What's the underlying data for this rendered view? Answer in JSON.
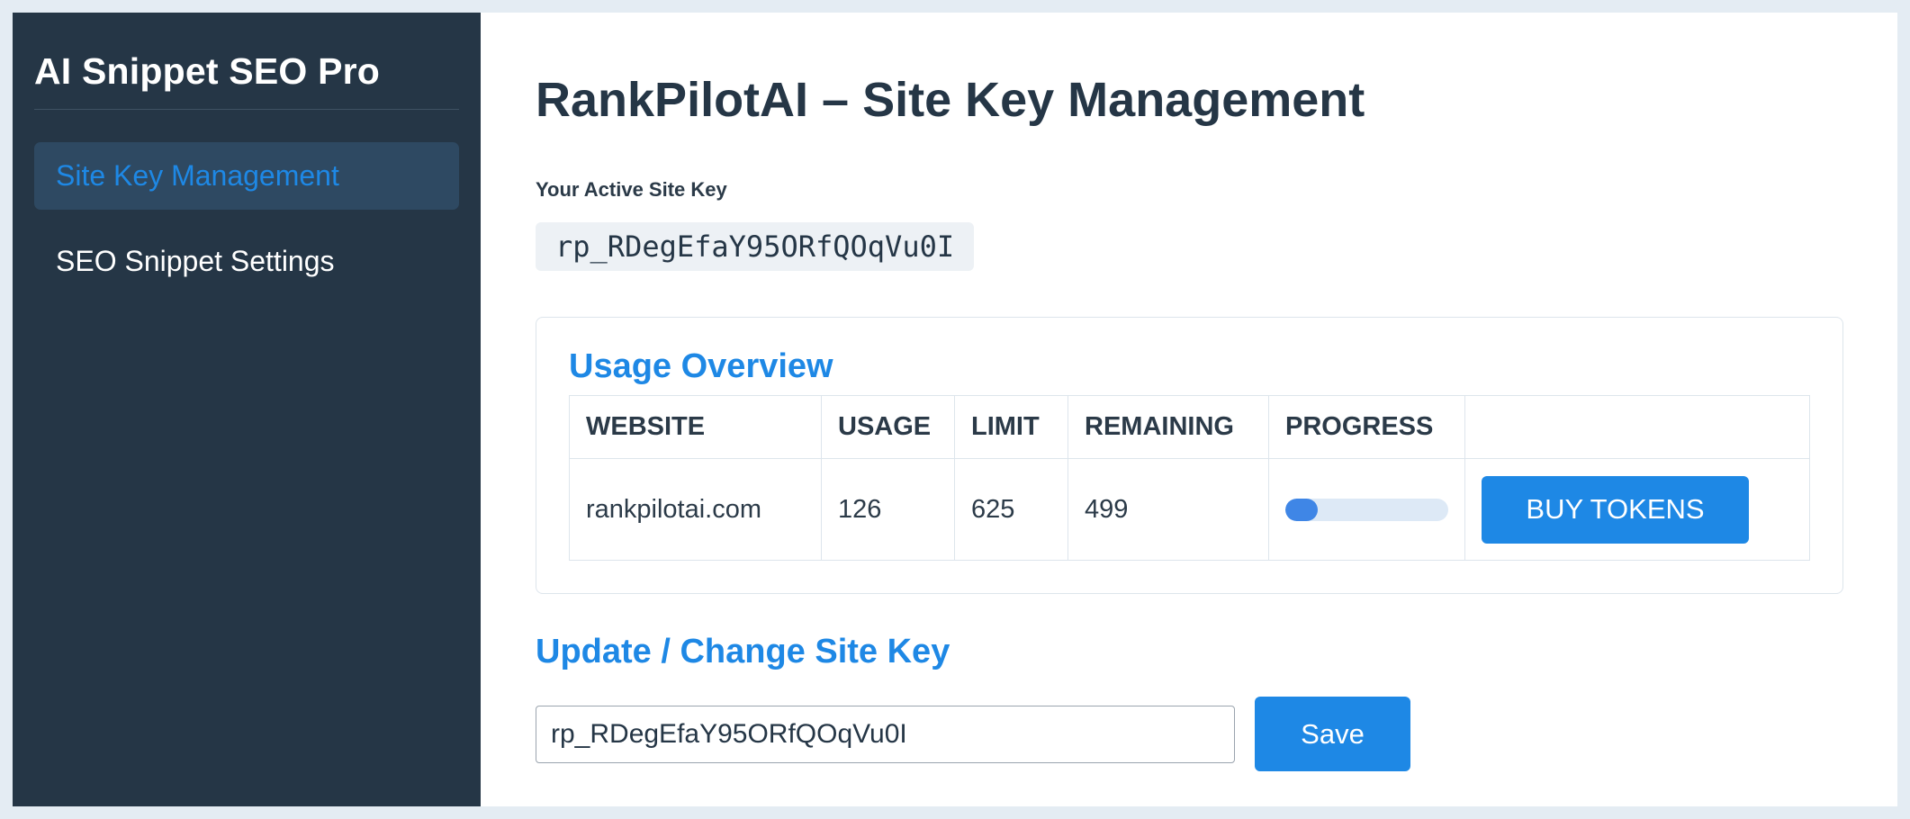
{
  "sidebar": {
    "brand": "AI Snippet SEO Pro",
    "items": [
      {
        "label": "Site Key Management",
        "active": true
      },
      {
        "label": "SEO Snippet Settings",
        "active": false
      }
    ]
  },
  "main": {
    "title": "RankPilotAI – Site Key Management",
    "key_label": "Your Active Site Key",
    "active_key": "rp_RDegEfaY95ORfQOqVu0I",
    "usage": {
      "title": "Usage Overview",
      "columns": [
        "WEBSITE",
        "USAGE",
        "LIMIT",
        "REMAINING",
        "PROGRESS",
        ""
      ],
      "rows": [
        {
          "website": "rankpilotai.com",
          "usage": "126",
          "limit": "625",
          "remaining": "499",
          "progress_fraction": 0.2,
          "action_label": "BUY TOKENS"
        }
      ]
    },
    "update": {
      "title": "Update / Change Site Key",
      "input_value": "rp_RDegEfaY95ORfQOqVu0I",
      "save_label": "Save"
    }
  },
  "colors": {
    "accent": "#1e88e5",
    "sidebar_bg": "#253646",
    "progress_fill": "#3f86e6",
    "progress_track": "#dde9f6"
  }
}
